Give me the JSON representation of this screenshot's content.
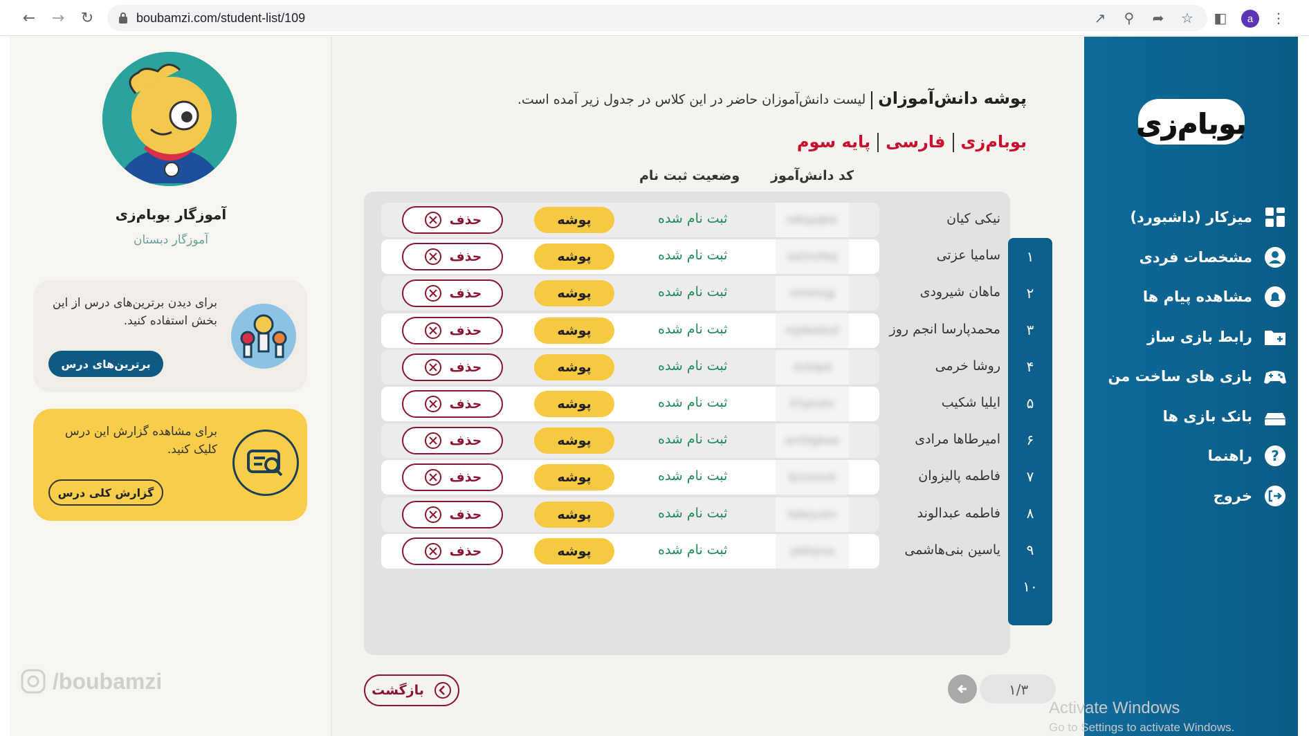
{
  "browser": {
    "url": "boubamzi.com/student-list/109",
    "avatar_letter": "a"
  },
  "sidebar": {
    "logo_text": "بوبام‌زی",
    "items": [
      {
        "label": "میزکار (داشبورد)",
        "icon": "dashboard-icon"
      },
      {
        "label": "مشخصات فردی",
        "icon": "user-icon"
      },
      {
        "label": "مشاهده پیام ها",
        "icon": "bell-icon"
      },
      {
        "label": "رابط بازی ساز",
        "icon": "folder-plus-icon"
      },
      {
        "label": "بازی های ساخت من",
        "icon": "gamepad-icon"
      },
      {
        "label": "بانک بازی ها",
        "icon": "stack-icon"
      },
      {
        "label": "راهنما",
        "icon": "help-icon"
      },
      {
        "label": "خروج",
        "icon": "logout-icon"
      }
    ]
  },
  "header": {
    "title": "پوشه دانش‌آموزان",
    "description": "لیست دانش‌آموزان حاضر در این کلاس در جدول زیر آمده است.",
    "breadcrumb": [
      "بوبام‌زی",
      "فارسی",
      "پایه سوم"
    ]
  },
  "table": {
    "col_code": "کد دانش‌آموز",
    "col_status": "وضعیت ثبت نام",
    "folder_label": "پوشه",
    "delete_label": "حذف",
    "rows": [
      {
        "num": "۱",
        "name": "نیکی کیان",
        "code": "ni8upqbtx",
        "status": "ثبت نام شده"
      },
      {
        "num": "۲",
        "name": "سامیا عزتی",
        "code": "sa2nvhkq",
        "status": "ثبت نام شده"
      },
      {
        "num": "۳",
        "name": "ماهان شیرودی",
        "code": "mh4rtcjg",
        "status": "ثبت نام شده"
      },
      {
        "num": "۴",
        "name": "محمدپارسا انجم روز",
        "code": "mp9wdnzf",
        "status": "ثبت نام شده"
      },
      {
        "num": "۵",
        "name": "روشا خرمی",
        "code": "rk3xlpd",
        "status": "ثبت نام شده"
      },
      {
        "num": "۶",
        "name": "ایلیا شکیب",
        "code": "il7qmshr",
        "status": "ثبت نام شده"
      },
      {
        "num": "۷",
        "name": "امیرطاها مرادی",
        "code": "am5tgbwe",
        "status": "ثبت نام شده"
      },
      {
        "num": "۸",
        "name": "فاطمه پالیزوان",
        "code": "fp1ovnck",
        "status": "ثبت نام شده"
      },
      {
        "num": "۹",
        "name": "فاطمه عبدالوند",
        "code": "fa6eyutm",
        "status": "ثبت نام شده"
      },
      {
        "num": "۱۰",
        "name": "یاسین بنی‌هاشمی",
        "code": "yb8sjrxa",
        "status": "ثبت نام شده"
      }
    ]
  },
  "footer": {
    "back_label": "بازگشت",
    "page_indicator": "۱/۳"
  },
  "profile": {
    "name": "آموزگار بوبام‌زی",
    "role": "آموزگار دبستان"
  },
  "cards": {
    "top_students_text": "برای دیدن برترین‌های درس از این بخش استفاده کنید.",
    "top_students_button": "برترین‌های درس",
    "report_text": "برای مشاهده گزارش این درس کلیک کنید.",
    "report_button": "گزارش کلی درس"
  },
  "watermark": "/boubamzi",
  "windows_notice": {
    "line1": "Activate Windows",
    "line2": "Go to Settings to activate Windows."
  },
  "colors": {
    "sidebar": "#0f6b9a",
    "accent_red": "#c8102e",
    "folder_yellow": "#f6c941",
    "delete_maroon": "#8a1530",
    "status_green": "#1f8a54"
  }
}
